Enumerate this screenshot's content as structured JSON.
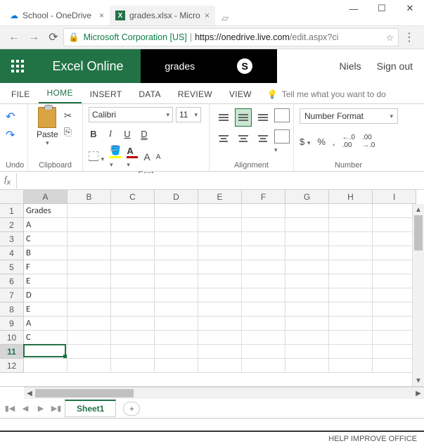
{
  "window": {
    "min": "—",
    "max": "☐",
    "close": "✕"
  },
  "browser": {
    "tabs": [
      {
        "label": "School - OneDrive",
        "favicon": "☁",
        "favcolor": "#0078d4"
      },
      {
        "label": "grades.xlsx - Micro",
        "favicon": "X",
        "favcolor": "#217346"
      }
    ],
    "url_org": "Microsoft Corporation [US]",
    "url_host": "https://onedrive.live.com",
    "url_path": "/edit.aspx?ci"
  },
  "header": {
    "brand": "Excel Online",
    "doc": "grades",
    "user": "Niels",
    "signout": "Sign out"
  },
  "ribbon": {
    "tabs": {
      "file": "FILE",
      "home": "HOME",
      "insert": "INSERT",
      "data": "DATA",
      "review": "REVIEW",
      "view": "VIEW"
    },
    "tellme": "Tell me what you want to do",
    "groups": {
      "undo": "Undo",
      "clipboard": "Clipboard",
      "font": "Font",
      "alignment": "Alignment",
      "number": "Number"
    },
    "paste": "Paste",
    "font_name": "Calibri",
    "font_size": "11",
    "btns": {
      "b": "B",
      "i": "I",
      "u": "U",
      "d": "D",
      "bigA": "A",
      "smallA": "A"
    },
    "number_format": "Number Format",
    "num_btns": {
      "dollar": "$",
      "percent": "%",
      "comma": ",",
      "dec_inc": ".0 .00",
      "dec_dec": ".00 .0"
    }
  },
  "grid": {
    "columns": [
      "A",
      "B",
      "C",
      "D",
      "E",
      "F",
      "G",
      "H",
      "I"
    ],
    "num_rows": 12,
    "selected_cell": {
      "row": 11,
      "col": 0
    },
    "data": {
      "1": {
        "A": "Grades"
      },
      "2": {
        "A": "A"
      },
      "3": {
        "A": "C"
      },
      "4": {
        "A": "B"
      },
      "5": {
        "A": "F"
      },
      "6": {
        "A": "E"
      },
      "7": {
        "A": "D"
      },
      "8": {
        "A": "E"
      },
      "9": {
        "A": "A"
      },
      "10": {
        "A": "C"
      }
    }
  },
  "sheets": {
    "active": "Sheet1"
  },
  "status": {
    "help": "HELP IMPROVE OFFICE"
  }
}
